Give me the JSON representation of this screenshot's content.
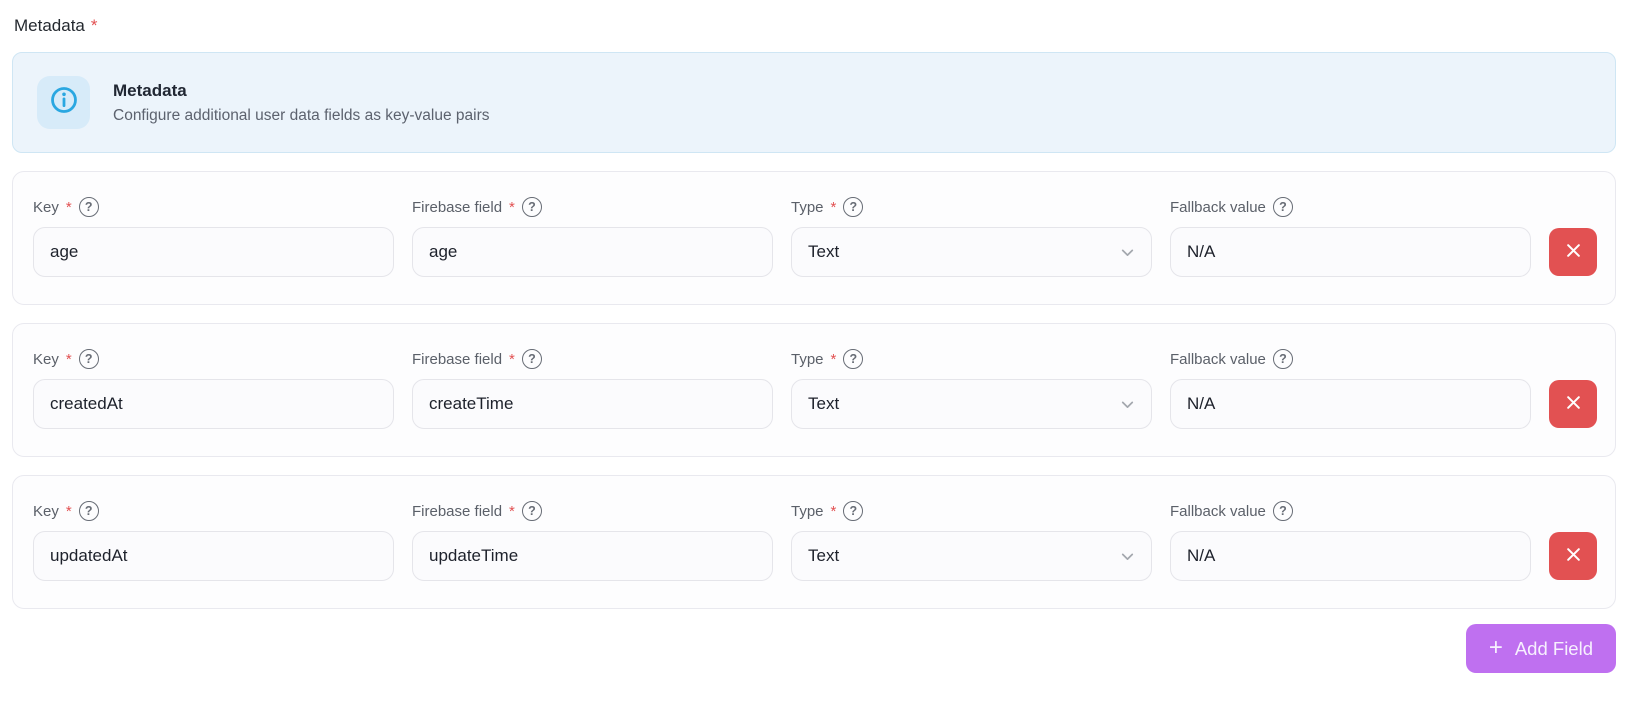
{
  "header": {
    "label": "Metadata",
    "required_marker": "*"
  },
  "banner": {
    "title": "Metadata",
    "description": "Configure additional user data fields as key-value pairs"
  },
  "field_labels": {
    "key": "Key",
    "firebase_field": "Firebase field",
    "type": "Type",
    "fallback_value": "Fallback value",
    "required_marker": "*"
  },
  "rows": [
    {
      "key": "age",
      "firebase_field": "age",
      "type": "Text",
      "fallback_value": "N/A"
    },
    {
      "key": "createdAt",
      "firebase_field": "createTime",
      "type": "Text",
      "fallback_value": "N/A"
    },
    {
      "key": "updatedAt",
      "firebase_field": "updateTime",
      "type": "Text",
      "fallback_value": "N/A"
    }
  ],
  "buttons": {
    "add_field": "Add Field",
    "add_field_plus": "+"
  },
  "icons": {
    "help": "?",
    "info": "info-circle",
    "chevron": "chevron-down",
    "close": "x-cross"
  },
  "colors": {
    "banner_bg": "#ecf4fb",
    "banner_border": "#cfe6f4",
    "info_icon_blue": "#2aa7e1",
    "danger_red": "#e25152",
    "accent_purple": "#bf70f0",
    "required_red": "#e25152"
  }
}
